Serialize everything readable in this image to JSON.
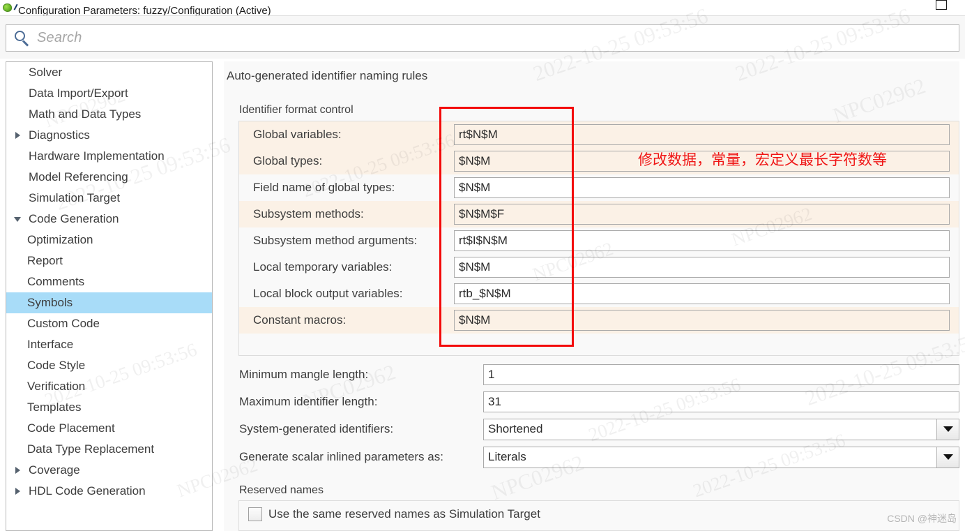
{
  "window": {
    "title": "Configuration Parameters: fuzzy/Configuration (Active)",
    "icon": "simulink-leaf-icon",
    "restore_button": "restore-window"
  },
  "search": {
    "placeholder": "Search",
    "value": "",
    "icon": "search-icon"
  },
  "sidebar": {
    "items": [
      {
        "label": "Solver",
        "depth": 0,
        "arrow": "none",
        "selected": false
      },
      {
        "label": "Data Import/Export",
        "depth": 0,
        "arrow": "none",
        "selected": false
      },
      {
        "label": "Math and Data Types",
        "depth": 0,
        "arrow": "none",
        "selected": false
      },
      {
        "label": "Diagnostics",
        "depth": 0,
        "arrow": "closed",
        "selected": false
      },
      {
        "label": "Hardware Implementation",
        "depth": 0,
        "arrow": "none",
        "selected": false
      },
      {
        "label": "Model Referencing",
        "depth": 0,
        "arrow": "none",
        "selected": false
      },
      {
        "label": "Simulation Target",
        "depth": 0,
        "arrow": "none",
        "selected": false
      },
      {
        "label": "Code Generation",
        "depth": 0,
        "arrow": "open",
        "selected": false
      },
      {
        "label": "Optimization",
        "depth": 1,
        "arrow": "none",
        "selected": false
      },
      {
        "label": "Report",
        "depth": 1,
        "arrow": "none",
        "selected": false
      },
      {
        "label": "Comments",
        "depth": 1,
        "arrow": "none",
        "selected": false
      },
      {
        "label": "Symbols",
        "depth": 1,
        "arrow": "none",
        "selected": true
      },
      {
        "label": "Custom Code",
        "depth": 1,
        "arrow": "none",
        "selected": false
      },
      {
        "label": "Interface",
        "depth": 1,
        "arrow": "none",
        "selected": false
      },
      {
        "label": "Code Style",
        "depth": 1,
        "arrow": "none",
        "selected": false
      },
      {
        "label": "Verification",
        "depth": 1,
        "arrow": "none",
        "selected": false
      },
      {
        "label": "Templates",
        "depth": 1,
        "arrow": "none",
        "selected": false
      },
      {
        "label": "Code Placement",
        "depth": 1,
        "arrow": "none",
        "selected": false
      },
      {
        "label": "Data Type Replacement",
        "depth": 1,
        "arrow": "none",
        "selected": false
      },
      {
        "label": "Coverage",
        "depth": 0,
        "arrow": "closed",
        "selected": false
      },
      {
        "label": "HDL Code Generation",
        "depth": 0,
        "arrow": "closed",
        "selected": false
      }
    ]
  },
  "main": {
    "section_title": "Auto-generated identifier naming rules",
    "group_title": "Identifier format control",
    "format_rows": [
      {
        "label": "Global variables:",
        "value": "rt$N$M",
        "shaded": true
      },
      {
        "label": "Global types:",
        "value": "$N$M",
        "shaded": true
      },
      {
        "label": "Field name of global types:",
        "value": "$N$M",
        "shaded": false
      },
      {
        "label": "Subsystem methods:",
        "value": "$N$M$F",
        "shaded": true
      },
      {
        "label": "Subsystem method arguments:",
        "value": "rt$I$N$M",
        "shaded": false
      },
      {
        "label": "Local temporary variables:",
        "value": "$N$M",
        "shaded": false
      },
      {
        "label": "Local block output variables:",
        "value": "rtb_$N$M",
        "shaded": false
      },
      {
        "label": "Constant macros:",
        "value": "$N$M",
        "shaded": true
      }
    ],
    "simple_rows": [
      {
        "label": "Minimum mangle length:",
        "value": "1",
        "type": "text"
      },
      {
        "label": "Maximum identifier length:",
        "value": "31",
        "type": "text"
      },
      {
        "label": "System-generated identifiers:",
        "value": "Shortened",
        "type": "combo"
      },
      {
        "label": "Generate scalar inlined parameters as:",
        "value": "Literals",
        "type": "combo"
      }
    ],
    "reserved_title": "Reserved names",
    "reserved_checkbox": {
      "label": "Use the same reserved names as Simulation Target",
      "checked": false
    }
  },
  "annotation": {
    "note_text": "修改数据，常量，宏定义最长字符数等",
    "rect_color": "#f30b0b",
    "note_color": "#ef1515"
  },
  "watermarks": {
    "date": "2022-10-25  09:53:56",
    "id": "NPC02962",
    "credit": "CSDN @神迷岛"
  }
}
